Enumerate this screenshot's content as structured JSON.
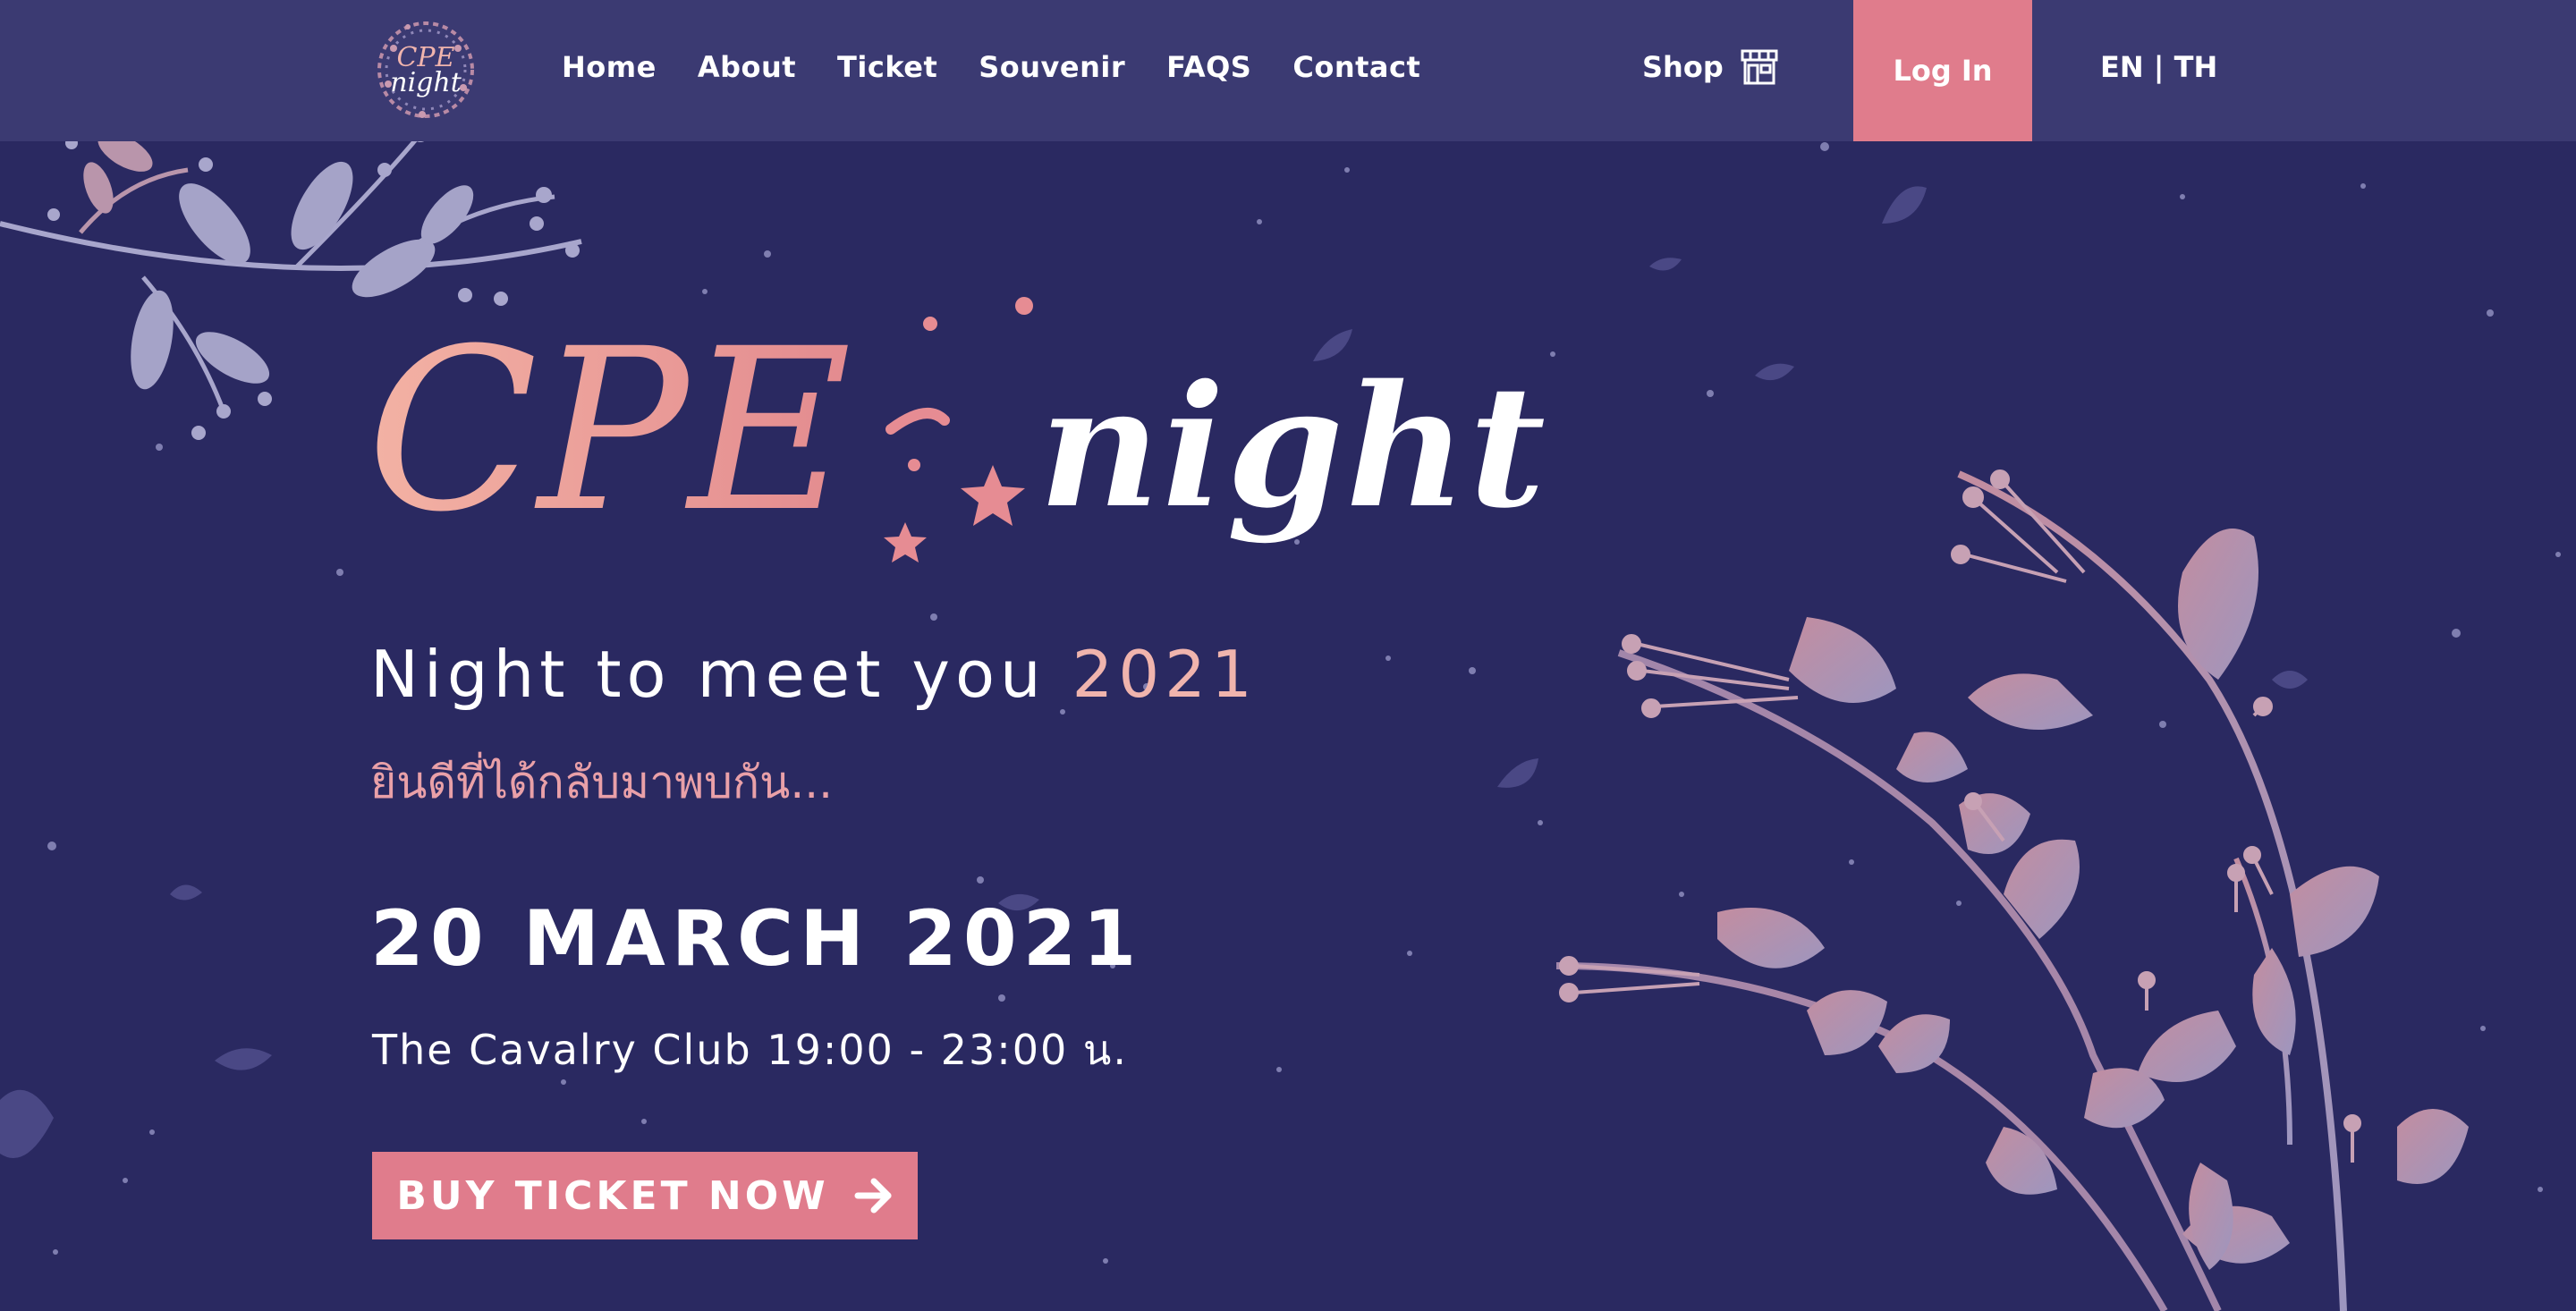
{
  "nav": {
    "logo_text": "CPE night",
    "links": [
      "Home",
      "About",
      "Ticket",
      "Souvenir",
      "FAQS",
      "Contact"
    ],
    "shop_label": "Shop",
    "shop_icon": "store-icon",
    "login_label": "Log In",
    "language": "EN | TH"
  },
  "hero": {
    "title_part1": "CPE",
    "title_part2": "night",
    "tagline_main": "Night to meet you",
    "tagline_year": "2021",
    "tagline_thai": "ยินดีที่ได้กลับมาพบกัน...",
    "date": "20 MARCH 2021",
    "venue": "The Cavalry Club 19:00 - 23:00 น.",
    "cta_label": "BUY TICKET NOW",
    "cta_icon": "arrow-right-icon"
  },
  "colors": {
    "background": "#2a2961",
    "navbar": "#3b3a72",
    "accent_pink": "#e07c8c",
    "title_pink": "#f0b4ad",
    "thai_pink": "#e9a0a8"
  }
}
